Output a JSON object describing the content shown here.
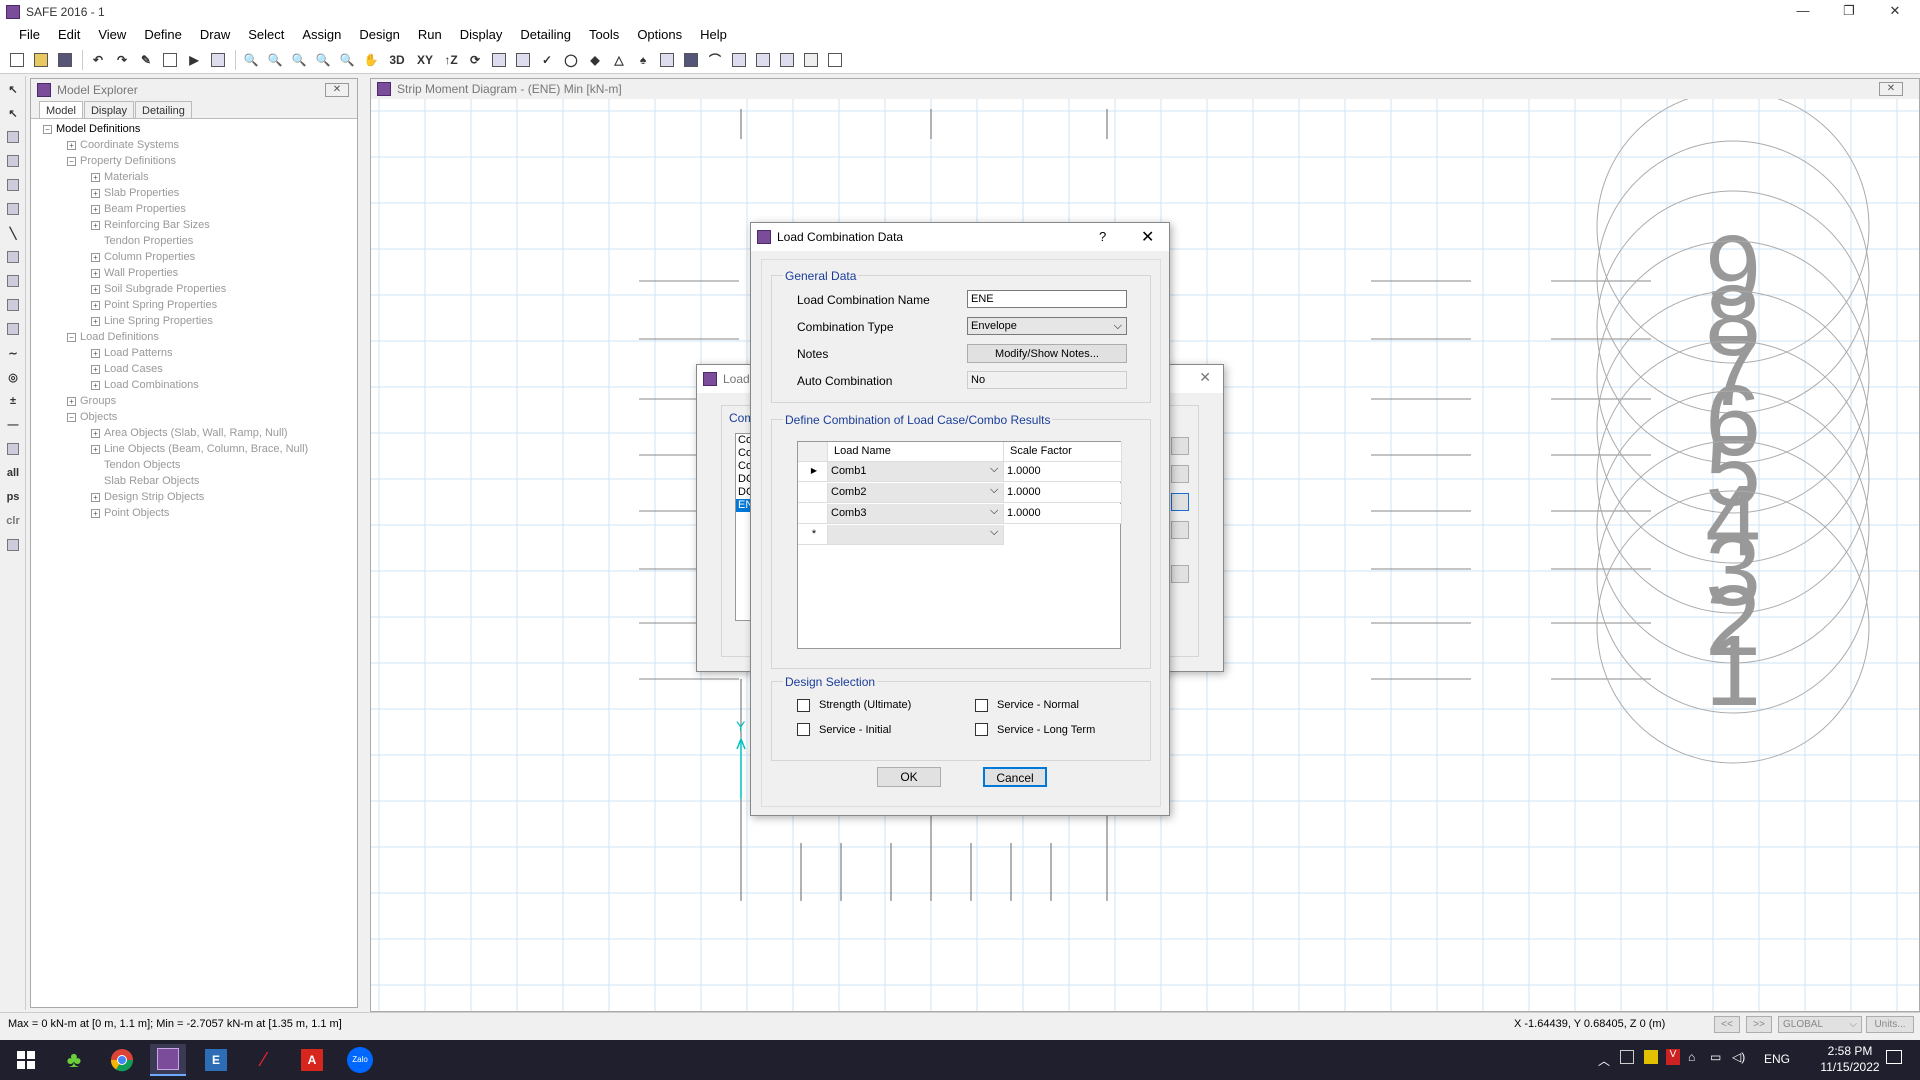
{
  "window": {
    "title": "SAFE 2016 - 1"
  },
  "menu": [
    "File",
    "Edit",
    "View",
    "Define",
    "Draw",
    "Select",
    "Assign",
    "Design",
    "Run",
    "Display",
    "Detailing",
    "Tools",
    "Options",
    "Help"
  ],
  "toolbar": {
    "view_3d": "3D",
    "view_xy": "XY",
    "view_z": "↑Z"
  },
  "left_toolbar": {
    "all": "all",
    "ps": "ps",
    "clr": "clr"
  },
  "explorer": {
    "title": "Model Explorer",
    "tabs": [
      "Model",
      "Display",
      "Detailing"
    ],
    "tree": [
      {
        "label": "Model Definitions",
        "level": 0,
        "toggle": "−"
      },
      {
        "label": "Coordinate Systems",
        "level": 1,
        "toggle": "+"
      },
      {
        "label": "Property Definitions",
        "level": 1,
        "toggle": "−"
      },
      {
        "label": "Materials",
        "level": 2,
        "toggle": "+"
      },
      {
        "label": "Slab Properties",
        "level": 2,
        "toggle": "+"
      },
      {
        "label": "Beam Properties",
        "level": 2,
        "toggle": "+"
      },
      {
        "label": "Reinforcing Bar Sizes",
        "level": 2,
        "toggle": "+"
      },
      {
        "label": "Tendon Properties",
        "level": 2,
        "toggle": ""
      },
      {
        "label": "Column Properties",
        "level": 2,
        "toggle": "+"
      },
      {
        "label": "Wall Properties",
        "level": 2,
        "toggle": "+"
      },
      {
        "label": "Soil Subgrade Properties",
        "level": 2,
        "toggle": "+"
      },
      {
        "label": "Point Spring Properties",
        "level": 2,
        "toggle": "+"
      },
      {
        "label": "Line Spring Properties",
        "level": 2,
        "toggle": "+"
      },
      {
        "label": "Load Definitions",
        "level": 1,
        "toggle": "−"
      },
      {
        "label": "Load Patterns",
        "level": 2,
        "toggle": "+"
      },
      {
        "label": "Load Cases",
        "level": 2,
        "toggle": "+"
      },
      {
        "label": "Load Combinations",
        "level": 2,
        "toggle": "+"
      },
      {
        "label": "Groups",
        "level": 1,
        "toggle": "+"
      },
      {
        "label": "Objects",
        "level": 1,
        "toggle": "−"
      },
      {
        "label": "Area Objects (Slab, Wall, Ramp, Null)",
        "level": 2,
        "toggle": "+"
      },
      {
        "label": "Line Objects (Beam, Column, Brace, Null)",
        "level": 2,
        "toggle": "+"
      },
      {
        "label": "Tendon Objects",
        "level": 2,
        "toggle": ""
      },
      {
        "label": "Slab Rebar Objects",
        "level": 2,
        "toggle": ""
      },
      {
        "label": "Design Strip Objects",
        "level": 2,
        "toggle": "+"
      },
      {
        "label": "Point Objects",
        "level": 2,
        "toggle": "+"
      }
    ]
  },
  "canvas": {
    "title": "Strip Moment Diagram   - (ENE)  Min  [kN-m]",
    "axis_y": "Y",
    "grid_labels": [
      "9",
      "8",
      "7",
      "6",
      "5",
      "4",
      "3",
      "2",
      "1"
    ]
  },
  "bg_dialog": {
    "title": "Load",
    "group": "Com",
    "list": [
      "Co",
      "Co",
      "Co",
      "DC",
      "DC",
      "EN"
    ]
  },
  "dialog": {
    "title": "Load Combination Data",
    "help": "?",
    "general_group": "General Data",
    "name_label": "Load Combination Name",
    "name_value": "ENE",
    "type_label": "Combination Type",
    "type_value": "Envelope",
    "notes_label": "Notes",
    "notes_button": "Modify/Show Notes...",
    "auto_label": "Auto Combination",
    "auto_value": "No",
    "define_group": "Define Combination of Load Case/Combo Results",
    "table_headers": [
      "Load Name",
      "Scale Factor"
    ],
    "rows": [
      {
        "name": "Comb1",
        "factor": "1.0000"
      },
      {
        "name": "Comb2",
        "factor": "1.0000"
      },
      {
        "name": "Comb3",
        "factor": "1.0000"
      }
    ],
    "new_row_marker": "*",
    "design_group": "Design Selection",
    "design_options": [
      "Strength (Ultimate)",
      "Service - Normal",
      "Service - Initial",
      "Service - Long Term"
    ],
    "ok": "OK",
    "cancel": "Cancel"
  },
  "status": {
    "left": "Max = 0 kN-m at [0 m, 1.1 m];  Min = -2.7057 kN-m at [1.35 m, 1.1 m]",
    "coords": "X -1.64439,  Y 0.68405,  Z 0  (m)",
    "prev": "<<",
    "next": ">>",
    "coord_system": "GLOBAL",
    "units": "Units..."
  },
  "taskbar": {
    "lang": "ENG",
    "time": "2:58 PM",
    "date": "11/15/2022",
    "zalo": "Zalo"
  },
  "colors": {
    "accent": "#1a3d9a",
    "axis": "#00c0c0",
    "grid": "#cfe3f3"
  }
}
